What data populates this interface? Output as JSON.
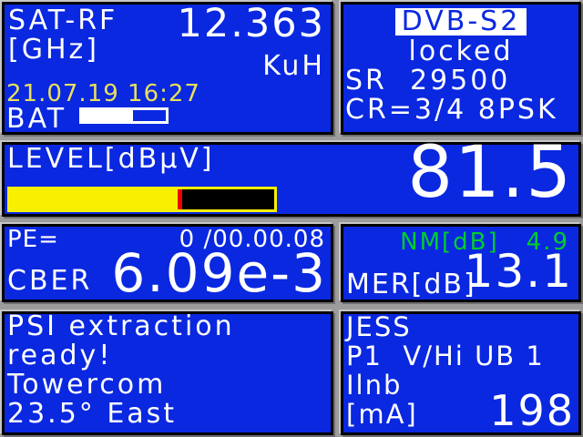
{
  "colors": {
    "panel_blue": "#0a28e0",
    "frame_gray": "#9c9c9c",
    "text_white": "#ffffff",
    "date_yellow": "#e8e05a",
    "bar_yellow": "#f8f000",
    "marker_red": "#ee0000",
    "ok_green": "#00cd2e"
  },
  "sat_rf": {
    "title": "SAT-RF",
    "unit": "[GHz]",
    "frequency": "12.363",
    "band": "KuH",
    "datetime": "21.07.19 16:27",
    "battery_label": "BAT",
    "battery_fill_percent": 60
  },
  "demod": {
    "standard": "DVB-S2",
    "lock_status": "locked",
    "symbol_rate": "SR  29500",
    "code_rate_modulation": "CR=3/4 8PSK"
  },
  "level": {
    "label": "LEVEL[dBµV]",
    "value": "81.5",
    "bar_fill_percent": 63.5
  },
  "errors": {
    "pe_label": "PE=",
    "pe_value": "0 /00.00.08",
    "cber_label": "CBER",
    "cber_value": "6.09e-3"
  },
  "quality": {
    "nm_label": "NM[dB]",
    "nm_value": "4.9",
    "mer_label": "MER[dB]",
    "mer_value": "13.1"
  },
  "psi": {
    "lines": [
      "PSI extraction",
      "ready!",
      "Towercom",
      "23.5° East"
    ]
  },
  "lnb": {
    "lines": [
      "JESS",
      "P1  V/Hi UB 1",
      "Ilnb",
      "[mA]"
    ],
    "current": "198"
  }
}
